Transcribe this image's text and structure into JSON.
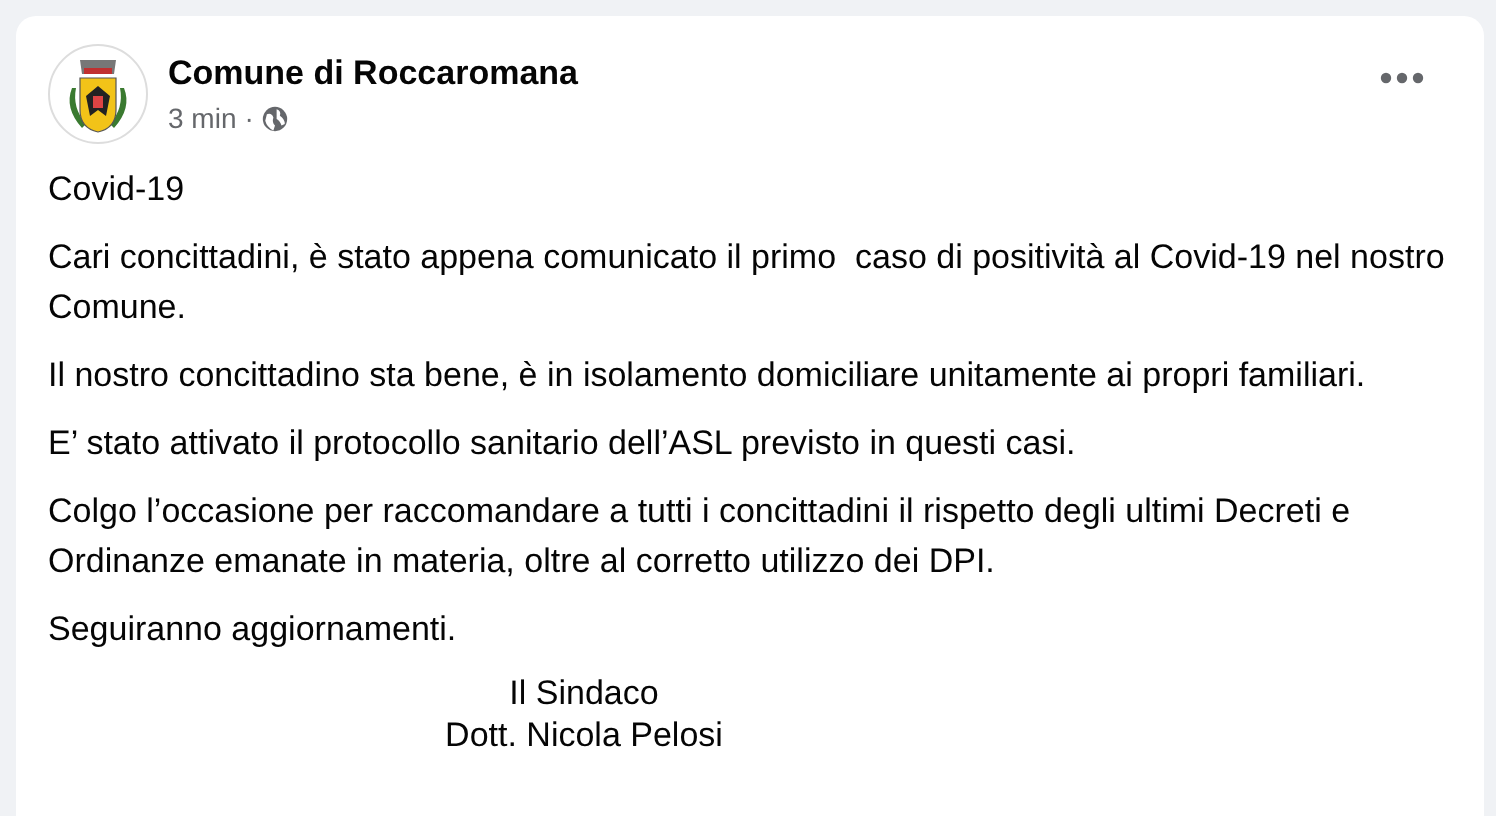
{
  "post": {
    "author": "Comune di Roccaromana",
    "time": "3 min",
    "separator": "·",
    "paragraphs": [
      "Covid-19",
      "Cari concittadini, è stato appena comunicato il primo  caso di positività al Covid-19 nel nostro Comune.",
      "Il nostro concittadino sta bene, è in isolamento domiciliare unitamente ai propri familiari.",
      "E’ stato attivato il protocollo sanitario dell’ASL previsto in questi casi.",
      "Colgo l’occasione per raccomandare a tutti i concittadini il rispetto degli ultimi Decreti e Ordinanze emanate in materia, oltre al corretto utilizzo dei DPI.",
      "Seguiranno aggiornamenti."
    ],
    "signature": [
      "Il Sindaco",
      "Dott. Nicola Pelosi"
    ]
  }
}
